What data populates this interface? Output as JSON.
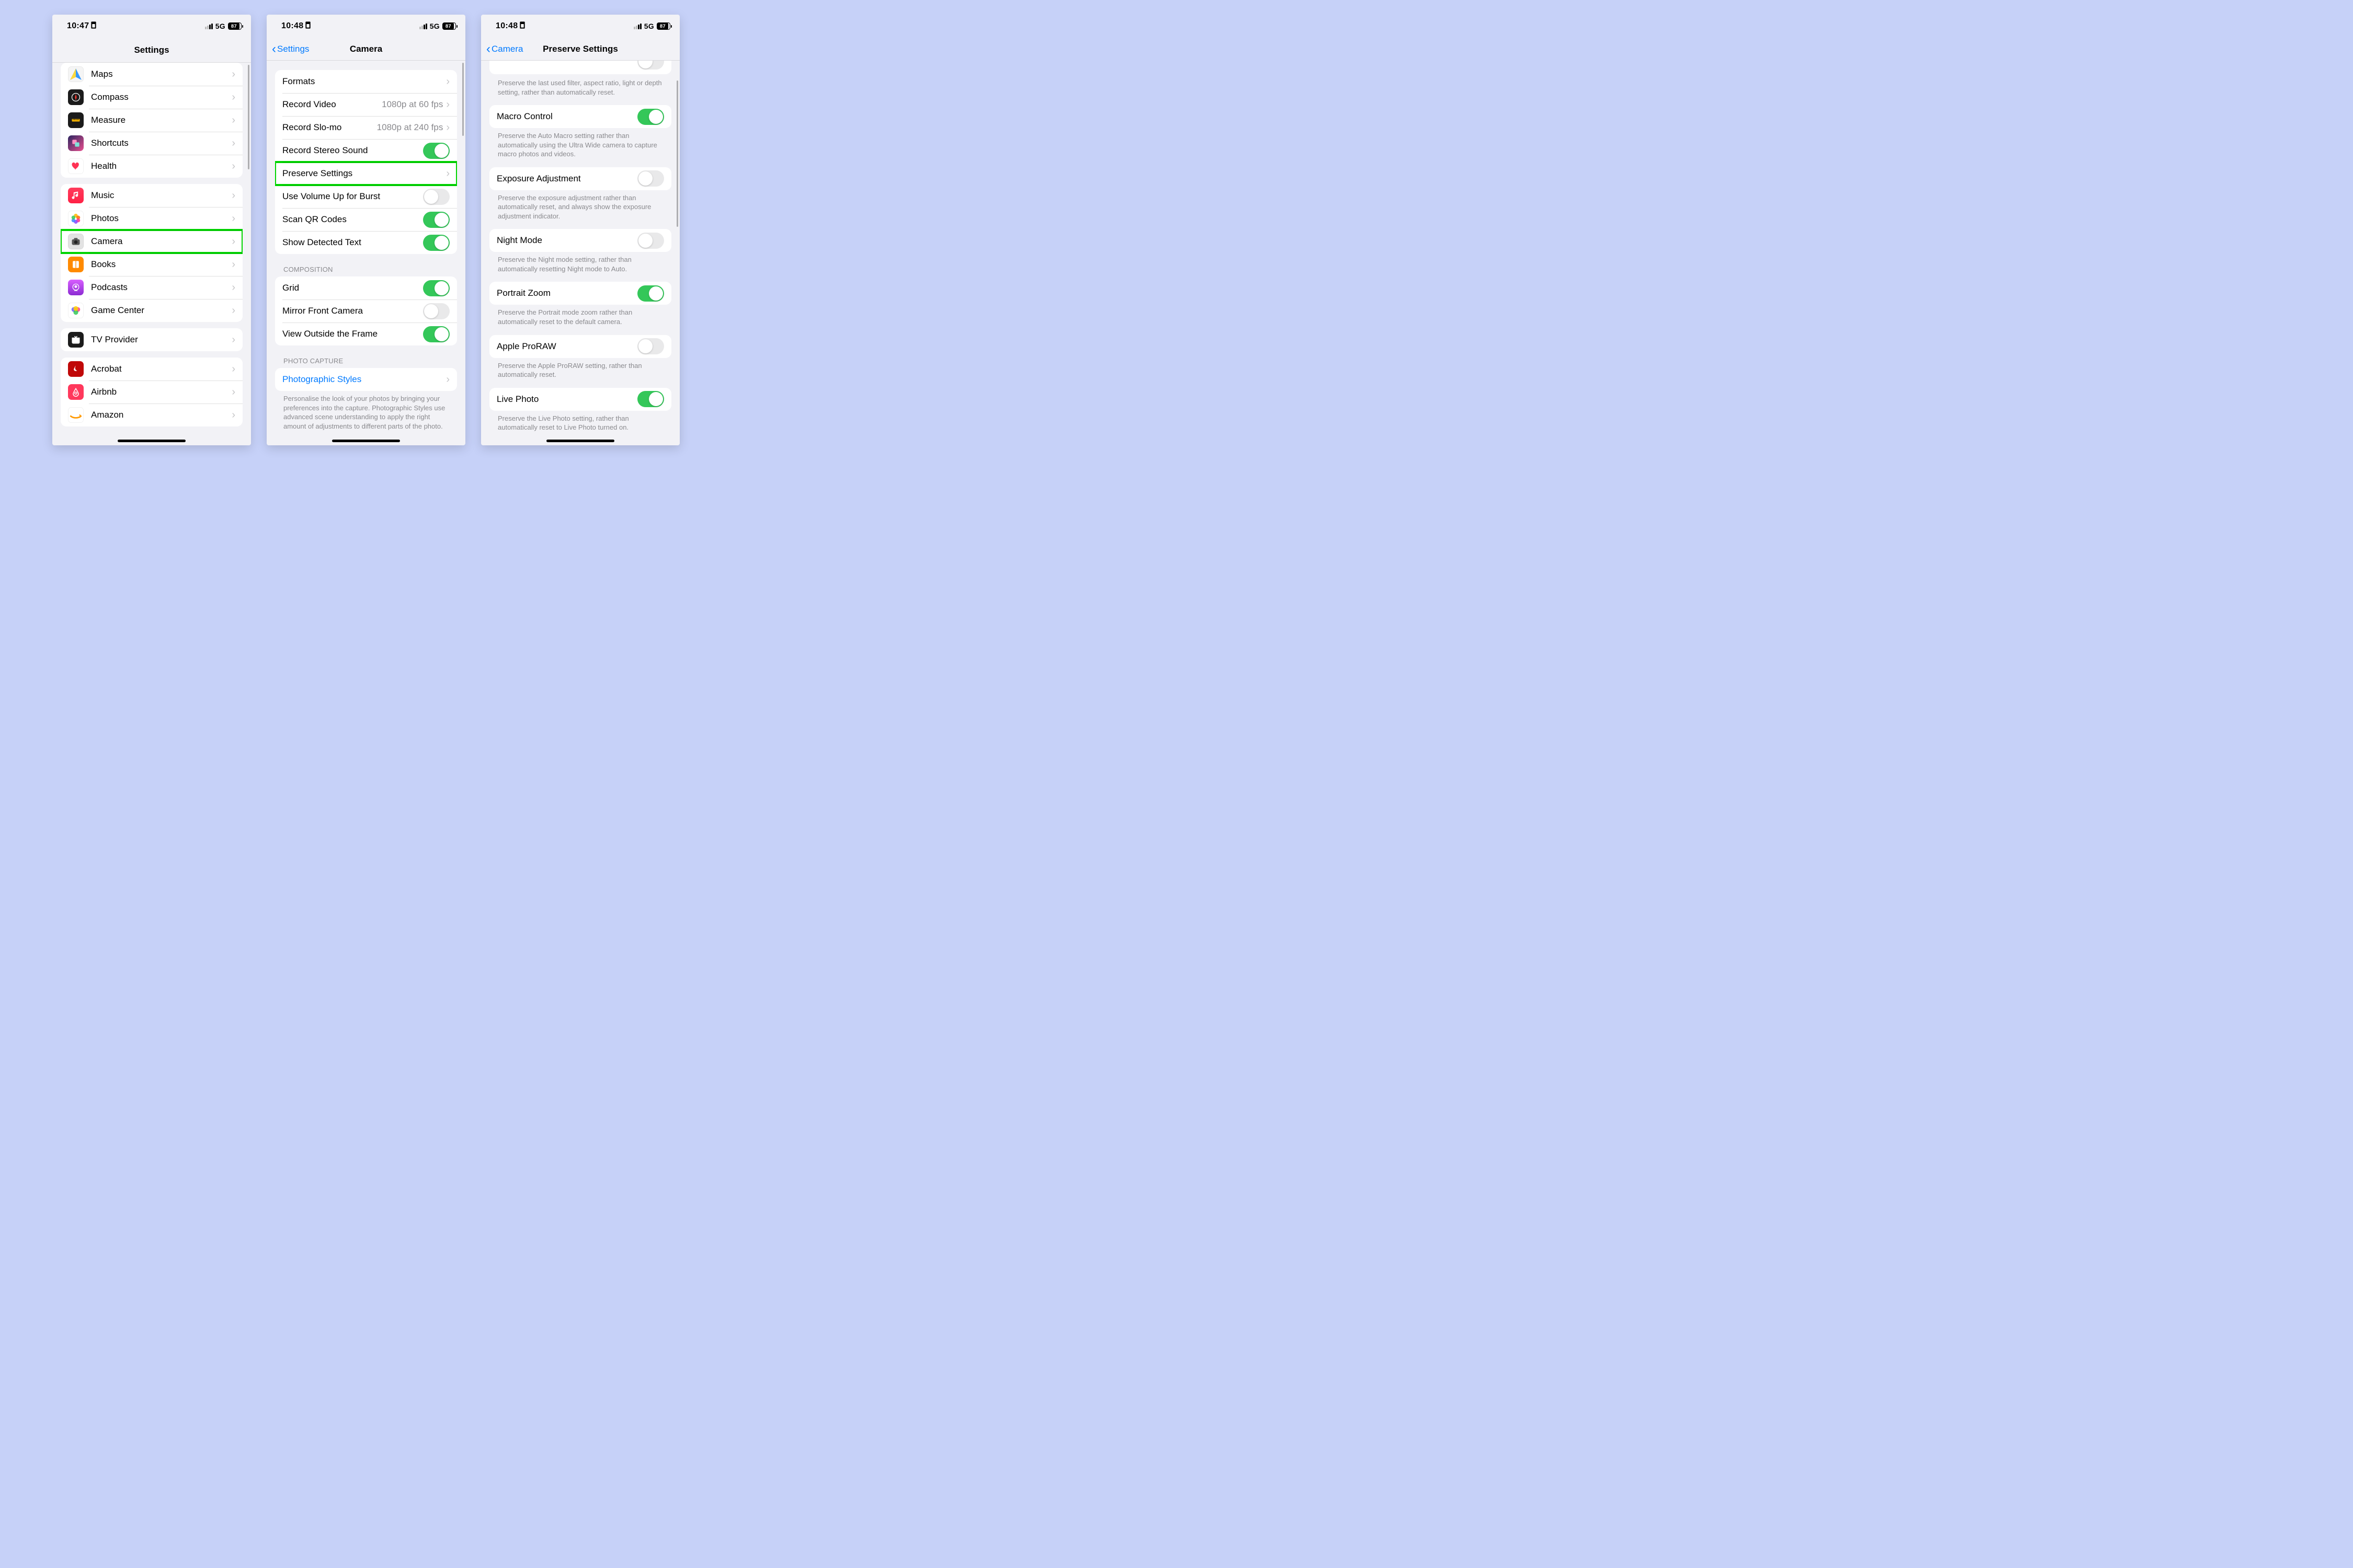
{
  "canvas_bg": "#c6d1f8",
  "phone1": {
    "time": "10:47",
    "network": "5G",
    "battery": "87",
    "title": "Settings",
    "highlight_item": "Camera",
    "group1": [
      {
        "label": "Maps",
        "icon_bg": "#f5f5f5",
        "glyph": "maps"
      },
      {
        "label": "Compass",
        "icon_bg": "#1b1b1b",
        "glyph": "compass"
      },
      {
        "label": "Measure",
        "icon_bg": "#1b1b1b",
        "glyph": "measure"
      },
      {
        "label": "Shortcuts",
        "icon_bg": "linear-gradient(135deg,#2b2560,#e84f8e)",
        "glyph": "shortcuts"
      },
      {
        "label": "Health",
        "icon_bg": "#ffffff",
        "glyph": "health"
      }
    ],
    "group2": [
      {
        "label": "Music",
        "icon_bg": "linear-gradient(#ff3b5c,#ff2145)",
        "glyph": "music"
      },
      {
        "label": "Photos",
        "icon_bg": "#ffffff",
        "glyph": "photos"
      },
      {
        "label": "Camera",
        "icon_bg": "#e3e3e3",
        "glyph": "camera",
        "highlight": true
      },
      {
        "label": "Books",
        "icon_bg": "#ff8a00",
        "glyph": "books"
      },
      {
        "label": "Podcasts",
        "icon_bg": "linear-gradient(#d85fff,#8b2bd2)",
        "glyph": "podcasts"
      },
      {
        "label": "Game Center",
        "icon_bg": "#ffffff",
        "glyph": "gamecenter"
      }
    ],
    "group3": [
      {
        "label": "TV Provider",
        "icon_bg": "#1b1b1b",
        "glyph": "tv"
      }
    ],
    "group4": [
      {
        "label": "Acrobat",
        "icon_bg": "#c00808",
        "glyph": "acrobat"
      },
      {
        "label": "Airbnb",
        "icon_bg": "#ff385c",
        "glyph": "airbnb"
      },
      {
        "label": "Amazon",
        "icon_bg": "#ffffff",
        "glyph": "amazon"
      }
    ]
  },
  "phone2": {
    "time": "10:48",
    "network": "5G",
    "battery": "87",
    "back": "Settings",
    "title": "Camera",
    "highlight_item": "Preserve Settings",
    "rows_main": [
      {
        "label": "Formats",
        "type": "chevron"
      },
      {
        "label": "Record Video",
        "type": "detail",
        "detail": "1080p at 60 fps"
      },
      {
        "label": "Record Slo-mo",
        "type": "detail",
        "detail": "1080p at 240 fps"
      },
      {
        "label": "Record Stereo Sound",
        "type": "toggle",
        "on": true
      },
      {
        "label": "Preserve Settings",
        "type": "chevron",
        "highlight": true
      },
      {
        "label": "Use Volume Up for Burst",
        "type": "toggle",
        "on": false
      },
      {
        "label": "Scan QR Codes",
        "type": "toggle",
        "on": true
      },
      {
        "label": "Show Detected Text",
        "type": "toggle",
        "on": true
      }
    ],
    "section_comp_header": "COMPOSITION",
    "rows_comp": [
      {
        "label": "Grid",
        "type": "toggle",
        "on": true
      },
      {
        "label": "Mirror Front Camera",
        "type": "toggle",
        "on": false
      },
      {
        "label": "View Outside the Frame",
        "type": "toggle",
        "on": true
      }
    ],
    "section_photo_header": "PHOTO CAPTURE",
    "rows_photo": [
      {
        "label": "Photographic Styles",
        "type": "chevron",
        "link": true
      }
    ],
    "photo_footer": "Personalise the look of your photos by bringing your preferences into the capture. Photographic Styles use advanced scene understanding to apply the right amount of adjustments to different parts of the photo."
  },
  "phone3": {
    "time": "10:48",
    "network": "5G",
    "battery": "87",
    "back": "Camera",
    "title": "Preserve Settings",
    "top_footer": "Preserve the last used filter, aspect ratio, light or depth setting, rather than automatically reset.",
    "items": [
      {
        "label": "Macro Control",
        "on": true,
        "footer": "Preserve the Auto Macro setting rather than automatically using the Ultra Wide camera to capture macro photos and videos."
      },
      {
        "label": "Exposure Adjustment",
        "on": false,
        "footer": "Preserve the exposure adjustment rather than automatically reset, and always show the exposure adjustment indicator."
      },
      {
        "label": "Night Mode",
        "on": false,
        "footer": "Preserve the Night mode setting, rather than automatically resetting Night mode to Auto."
      },
      {
        "label": "Portrait Zoom",
        "on": true,
        "footer": "Preserve the Portrait mode zoom rather than automatically reset to the default camera."
      },
      {
        "label": "Apple ProRAW",
        "on": false,
        "footer": "Preserve the Apple ProRAW setting, rather than automatically reset."
      },
      {
        "label": "Live Photo",
        "on": true,
        "footer": "Preserve the Live Photo setting, rather than automatically reset to Live Photo turned on."
      }
    ]
  }
}
